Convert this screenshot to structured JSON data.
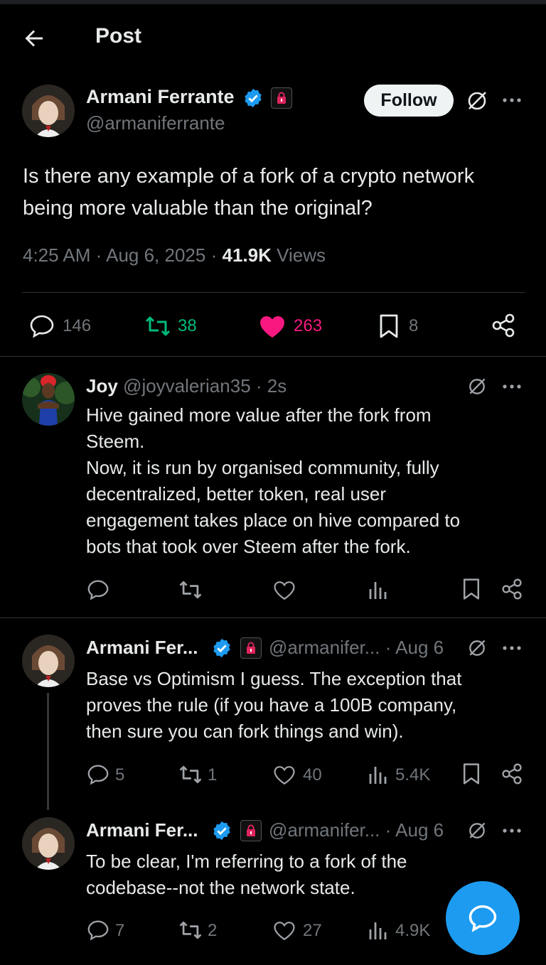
{
  "header": {
    "title": "Post"
  },
  "post": {
    "author_name": "Armani Ferrante",
    "author_handle": "@armaniferrante",
    "follow_label": "Follow",
    "text_line1": "Is there any example of a fork of a crypto network",
    "text_line2": "being more valuable than the original?",
    "time": "4:25 AM",
    "date": "Aug 6, 2025",
    "views_count": "41.9K",
    "views_label": "Views",
    "replies": "146",
    "reposts": "38",
    "likes": "263",
    "bookmarks": "8"
  },
  "replies": [
    {
      "name": "Joy",
      "handle": "@joyvalerian35",
      "time": "2s",
      "lines": [
        "Hive gained more value after the fork from",
        "Steem.",
        "Now, it is run by organised community, fully",
        "decentralized, better token, real user",
        "engagement takes place on hive compared to",
        "bots that took over Steem after the fork."
      ]
    },
    {
      "name": "Armani Fer...",
      "handle": "@armanifer...",
      "time": "Aug 6",
      "lines": [
        "Base vs Optimism I guess. The exception that",
        "proves the rule (if you have a 100B company,",
        "then sure you can fork things and win)."
      ],
      "replies": "5",
      "reposts": "1",
      "likes": "40",
      "views": "5.4K"
    },
    {
      "name": "Armani Fer...",
      "handle": "@armanifer...",
      "time": "Aug 6",
      "lines": [
        "To be clear, I'm referring to a fork of the",
        "codebase--not the network state."
      ],
      "replies": "7",
      "reposts": "2",
      "likes": "27",
      "views": "4.9K"
    }
  ],
  "separator": "·",
  "colors": {
    "accent": "#1d9bf0",
    "like": "#f91880",
    "repost": "#00ba7c",
    "muted": "#71767b"
  }
}
